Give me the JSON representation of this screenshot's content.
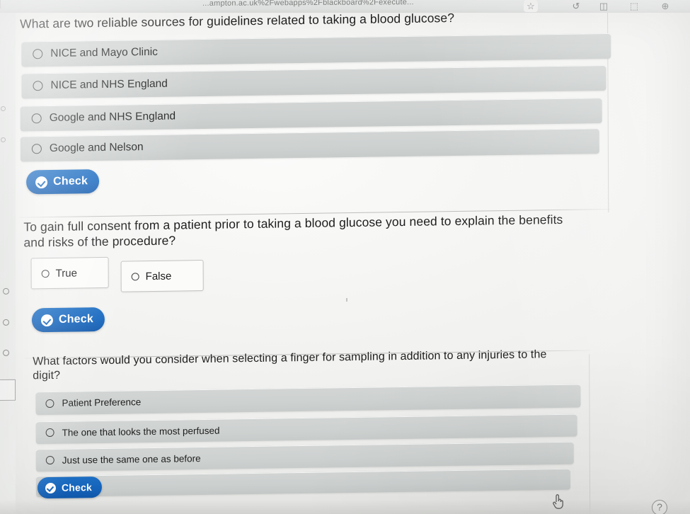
{
  "browser": {
    "url_fragment": "...ampton.ac.uk%2Fwebapps%2Fblackboard%2Fexecute...",
    "icons": {
      "bookmark": "☆",
      "refresh": "↺",
      "reading_list": "◫",
      "collections": "⬚",
      "profile": "⊕"
    }
  },
  "questions": [
    {
      "id": "q1",
      "prompt": "What are two reliable sources for guidelines related to taking a blood glucose?",
      "type": "multiple-choice",
      "options": [
        {
          "label": "NICE and Mayo Clinic",
          "selected": false
        },
        {
          "label": "NICE and NHS England",
          "selected": false
        },
        {
          "label": "Google and NHS England",
          "selected": false
        },
        {
          "label": "Google and Nelson",
          "selected": false
        }
      ],
      "check_label": "Check"
    },
    {
      "id": "q2",
      "prompt": "To gain full consent from a patient prior to taking a blood glucose you need to explain the benefits and risks of the procedure?",
      "type": "true-false",
      "options": [
        {
          "label": "True",
          "selected": false
        },
        {
          "label": "False",
          "selected": false
        }
      ],
      "check_label": "Check"
    },
    {
      "id": "q3",
      "prompt": "What factors would you consider when selecting a finger for sampling in addition to any injuries to the digit?",
      "type": "multiple-choice",
      "options": [
        {
          "label": "Patient Preference",
          "selected": false
        },
        {
          "label": "The one that looks the most perfused",
          "selected": false
        },
        {
          "label": "Just use the same one as before",
          "selected": false
        },
        {
          "label": "",
          "selected": false
        }
      ],
      "check_label": "Check"
    }
  ],
  "footer": {
    "help_icon": "?",
    "cursor_icon": "pointing-hand"
  },
  "colors": {
    "accent_blue": "#1565bd",
    "option_gray": "#cdd1d0",
    "page_background": "#f2f2f0",
    "text": "#1d1d1d"
  }
}
